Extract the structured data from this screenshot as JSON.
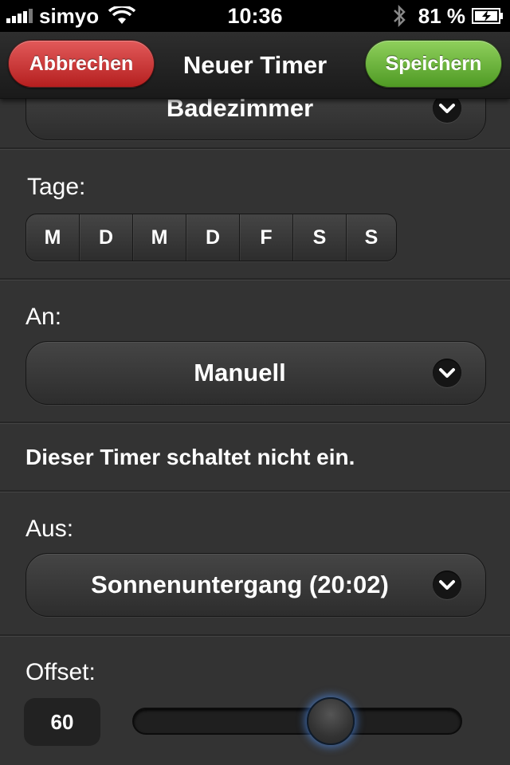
{
  "status_bar": {
    "carrier": "simyo",
    "time": "10:36",
    "battery_percent": "81 %",
    "signal_icon": "signal-bars-icon",
    "wifi_icon": "wifi-icon",
    "bluetooth_icon": "bluetooth-icon",
    "battery_icon": "battery-charging-icon"
  },
  "nav": {
    "title": "Neuer Timer",
    "cancel_label": "Abbrechen",
    "save_label": "Speichern",
    "cancel_color": "#c62b2b",
    "save_color": "#6ab53a"
  },
  "room_select": {
    "value": "Badezimmer"
  },
  "days": {
    "label": "Tage:",
    "items": [
      "M",
      "D",
      "M",
      "D",
      "F",
      "S",
      "S"
    ]
  },
  "on": {
    "label": "An:",
    "value": "Manuell",
    "info": "Dieser Timer schaltet nicht ein."
  },
  "off": {
    "label": "Aus:",
    "value": "Sonnenuntergang (20:02)"
  },
  "offset": {
    "label": "Offset:",
    "value": "60",
    "slider_fraction": 0.62
  }
}
